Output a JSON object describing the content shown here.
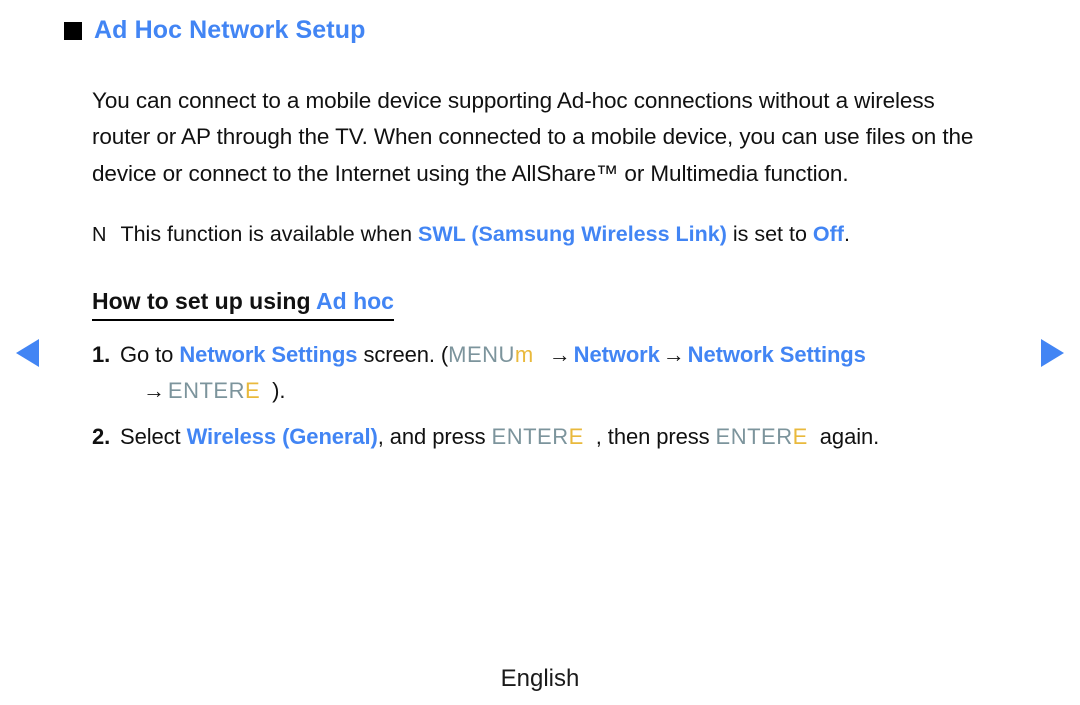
{
  "page": {
    "background_color": "#ffffff",
    "accent_blue": "#4285f4",
    "key_label_color": "#7c949c",
    "key_glyph_color": "#e9b93c"
  },
  "title": {
    "bullet": "black-square-bullet",
    "text": "Ad Hoc Network Setup"
  },
  "intro": {
    "paragraph": "You can connect to a mobile device supporting Ad-hoc connections without a wireless router or AP through the TV. When connected to a mobile device, you can use files on the device or connect to the Internet using the AllShare™ or Multimedia function."
  },
  "note": {
    "marker": "N",
    "text_before": "This function is available when ",
    "highlight": "SWL (Samsung Wireless Link)",
    "text_middle": " is set to ",
    "highlight_2": "Off",
    "text_after": "."
  },
  "howto": {
    "heading_plain": "How to set up using ",
    "heading_accent": "Ad hoc"
  },
  "steps": [
    {
      "number": "1.",
      "line1_before": "Go to ",
      "line1_link": "Network Settings",
      "line1_after": " screen. (",
      "key1_label": "MENU",
      "key1_glyph": "m",
      "arrow1": "→",
      "link2": "Network",
      "arrow2": "→",
      "link3": "Network Settings",
      "line2_arrow": "→",
      "key2_label": "ENTER",
      "key2_glyph": "E",
      "line2_after": ")."
    },
    {
      "number": "2.",
      "before": "Select ",
      "link": "Wireless (General)",
      "middle": ", and press ",
      "key1_label": "ENTER",
      "key1_glyph": "E",
      "middle2": ", then press ",
      "key2_label": "ENTER",
      "key2_glyph": "E",
      "after": "again."
    }
  ],
  "nav": {
    "prev_label": "previous-page",
    "next_label": "next-page"
  },
  "footer": {
    "language": "English"
  }
}
